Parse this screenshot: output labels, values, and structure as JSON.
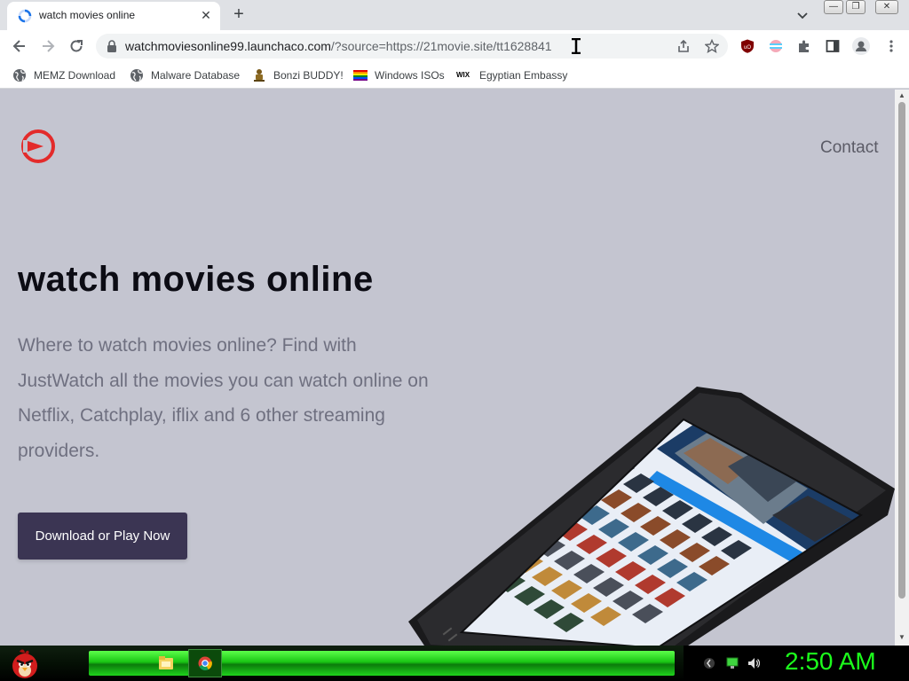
{
  "browser": {
    "tab": {
      "title": "watch movies online",
      "close": "✕"
    },
    "new_tab": "+",
    "url": {
      "host": "watchmoviesonline99.launchaco.com",
      "path": "/?source=https://21movie.site/tt1628841"
    },
    "window_controls": {
      "minimize": "—",
      "restore": "❐",
      "close": "✕"
    }
  },
  "bookmarks": [
    {
      "label": "MEMZ Download",
      "icon": "globe-icon"
    },
    {
      "label": "Malware Database",
      "icon": "globe-icon"
    },
    {
      "label": "Bonzi BUDDY!",
      "icon": "bonzi-icon"
    },
    {
      "label": "Windows ISOs",
      "icon": "windows-flag-icon"
    },
    {
      "label": "Egyptian Embassy",
      "icon": "wix-icon",
      "icon_text": "WIX"
    }
  ],
  "page": {
    "nav": {
      "contact": "Contact"
    },
    "headline": "watch movies online",
    "subtext": "Where to watch movies online? Find with JustWatch all the movies you can watch online on Netflix, Catchplay, iflix and 6 other streaming providers.",
    "cta": "Download or Play Now",
    "colors": {
      "background": "#c4c5d0",
      "logo_red": "#e32b2b",
      "cta_bg": "#3b3553"
    }
  },
  "taskbar": {
    "clock": "2:50 AM",
    "colors": {
      "band": "#19c514",
      "clock": "#1cff1c"
    }
  }
}
